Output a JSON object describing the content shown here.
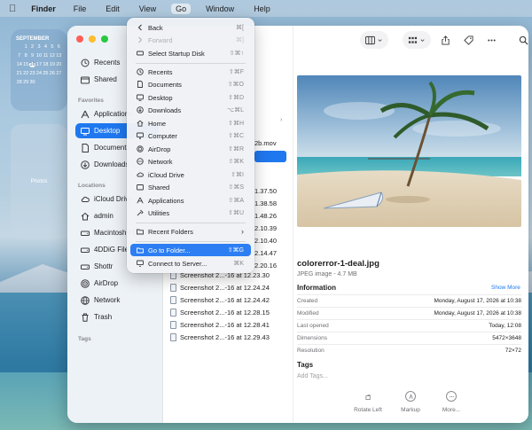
{
  "menubar": {
    "apple": "",
    "items": [
      "Finder",
      "File",
      "Edit",
      "View",
      "Go",
      "Window",
      "Help"
    ]
  },
  "calendar_widget": {
    "month": "SEPTEMBER",
    "days": [
      "1",
      "2",
      "3",
      "4",
      "5",
      "6",
      "7",
      "8",
      "9",
      "10",
      "11",
      "12",
      "13",
      "14",
      "15",
      "16",
      "17",
      "18",
      "19",
      "20",
      "21",
      "22",
      "23",
      "24",
      "25",
      "26",
      "27",
      "28",
      "29",
      "30"
    ],
    "today": "16"
  },
  "photos_widget": {
    "label": "Photos"
  },
  "sidebar": {
    "items": [
      {
        "label": "Recents"
      },
      {
        "label": "Shared"
      }
    ],
    "favorites_header": "Favorites",
    "favorites": [
      {
        "label": "Applications"
      },
      {
        "label": "Desktop"
      },
      {
        "label": "Documents"
      },
      {
        "label": "Downloads"
      }
    ],
    "locations_header": "Locations",
    "locations": [
      {
        "label": "iCloud Drive"
      },
      {
        "label": "admin"
      },
      {
        "label": "Macintosh HD"
      },
      {
        "label": "4DDiG File"
      },
      {
        "label": "Shottr"
      },
      {
        "label": "AirDrop"
      },
      {
        "label": "Network"
      },
      {
        "label": "Trash"
      }
    ],
    "tags_header": "Tags"
  },
  "file_list": {
    "partial_name": "2b.mov",
    "partial_times": [
      "1.37.50",
      "1.38.58",
      "1.48.26",
      "2.10.39",
      "2.10.40",
      "2.14.47",
      "2.20.16"
    ],
    "rows": [
      "Screenshot 2...-16 at 12.23.30",
      "Screenshot 2...-16 at 12.24.24",
      "Screenshot 2...-16 at 12.24.42",
      "Screenshot 2...-16 at 12.28.15",
      "Screenshot 2...-16 at 12.28.41",
      "Screenshot 2...-16 at 12.29.43"
    ]
  },
  "preview": {
    "filename": "colorerror-1-deal.jpg",
    "meta": "JPEG image - 4.7 MB",
    "info_header": "Information",
    "show_more": "Show More",
    "info": [
      {
        "k": "Created",
        "v": "Monday, August 17, 2026 at 10:38"
      },
      {
        "k": "Modified",
        "v": "Monday, August 17, 2026 at 10:38"
      },
      {
        "k": "Last opened",
        "v": "Today, 12:08"
      },
      {
        "k": "Dimensions",
        "v": "5472×3648"
      },
      {
        "k": "Resolution",
        "v": "72×72"
      }
    ],
    "tags_header": "Tags",
    "tags_placeholder": "Add Tags...",
    "actions": [
      "Rotate Left",
      "Markup",
      "More..."
    ]
  },
  "go_menu": {
    "items": [
      {
        "label": "Back",
        "shortcut": "⌘[",
        "icon": "chevron-left-icon"
      },
      {
        "label": "Forward",
        "shortcut": "⌘]",
        "icon": "chevron-right-icon",
        "disabled": true
      },
      {
        "label": "Select Startup Disk",
        "shortcut": "⇧⌘↑",
        "icon": "startup-disk-icon"
      },
      {
        "label": "Recents",
        "shortcut": "⇧⌘F",
        "icon": "clock-icon"
      },
      {
        "label": "Documents",
        "shortcut": "⇧⌘O",
        "icon": "document-icon"
      },
      {
        "label": "Desktop",
        "shortcut": "⇧⌘D",
        "icon": "desktop-icon"
      },
      {
        "label": "Downloads",
        "shortcut": "⌥⌘L",
        "icon": "download-icon"
      },
      {
        "label": "Home",
        "shortcut": "⇧⌘H",
        "icon": "home-icon"
      },
      {
        "label": "Computer",
        "shortcut": "⇧⌘C",
        "icon": "computer-icon"
      },
      {
        "label": "AirDrop",
        "shortcut": "⇧⌘R",
        "icon": "airdrop-icon"
      },
      {
        "label": "Network",
        "shortcut": "⇧⌘K",
        "icon": "network-icon"
      },
      {
        "label": "iCloud Drive",
        "shortcut": "⇧⌘I",
        "icon": "cloud-icon"
      },
      {
        "label": "Shared",
        "shortcut": "⇧⌘S",
        "icon": "shared-icon"
      },
      {
        "label": "Applications",
        "shortcut": "⇧⌘A",
        "icon": "applications-icon"
      },
      {
        "label": "Utilities",
        "shortcut": "⇧⌘U",
        "icon": "utilities-icon"
      },
      {
        "label": "Recent Folders",
        "shortcut": "",
        "icon": "folder-icon"
      },
      {
        "label": "Go to Folder...",
        "shortcut": "⇧⌘G",
        "icon": "folder-icon",
        "highlight": true
      },
      {
        "label": "Connect to Server...",
        "shortcut": "⌘K",
        "icon": "server-icon"
      }
    ]
  },
  "colors": {
    "accent": "#1f78f0",
    "menu_highlight": "#2c7ef2",
    "traffic_red": "#ff5f57",
    "traffic_yellow": "#febc2e",
    "traffic_green": "#28c840"
  }
}
